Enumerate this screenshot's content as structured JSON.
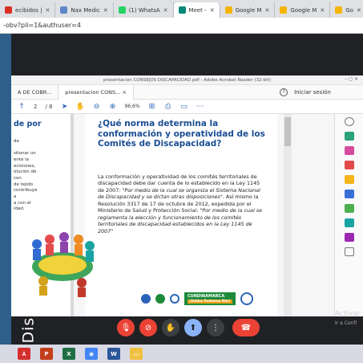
{
  "browser": {
    "tabs": [
      {
        "label": "ecibidos |",
        "color": "#d93025"
      },
      {
        "label": "Nax Medic",
        "color": "#5f86c8"
      },
      {
        "label": "(1) WhatsA",
        "color": "#25d366"
      },
      {
        "label": "Meet -",
        "color": "#00897b"
      },
      {
        "label": "Google M",
        "color": "#f4b400"
      },
      {
        "label": "Google M",
        "color": "#f4b400"
      },
      {
        "label": "Go",
        "color": "#f4b400"
      }
    ],
    "address": "-obv?pli=1&authuser=4"
  },
  "side_text": "Discapacidad",
  "acrobat": {
    "window_title": "presentacion CONSEJOS DISCAPACIDAD.pdf - Adobe Acrobat Reader (32-bit)",
    "window_controls": "–  ◻  ✕",
    "tabs": [
      "A DE COBR...",
      "presentacion CONS...  ×"
    ],
    "help": "?",
    "signin": "Iniciar sesión",
    "toolbar": {
      "page": "2",
      "total": "/ 8",
      "zoom": "96,6%"
    },
    "left_page": {
      "title": "de por",
      "text": "de\n\nstionar un\nente la\necisiones,\nolución de\ncon\nde tejido\ncontribuye\na\na con el\nidad."
    },
    "page": {
      "title": "¿Qué norma determina la conformación y operatividad de los Comités de Discapacidad?",
      "body_plain": "La conformación y operatividad de los comités territoriales de discapacidad debe dar cuenta de lo establecido en la Ley 1145 de 2007: ",
      "body_quote1": "\"Por medio de la cual se organiza el Sistema Nacional de Discapacidad y se dictan otras disposiciones\"",
      "body_mid": ". Así mismo la Resolución 3317 de 17 de octubre de 2012, expedida por el Ministerio de Salud y Protección Social: ",
      "body_quote2": "\"Por medio de la cual se reglamenta la elección y funcionamiento de los comités territoriales de discapacidad establecidos en la Ley 1145 de 2007\"",
      "logo_cund": "CUNDINAMARCA",
      "logo_cund_sub": "¡Unidos Podemos Más!"
    }
  },
  "overlay": {
    "line1": "Activar",
    "line2": "Ir a Confi"
  },
  "taskbar": [
    {
      "name": "acrobat",
      "label": "⅄",
      "color": "#d32f2f"
    },
    {
      "name": "powerpoint",
      "label": "P",
      "color": "#c43e1c"
    },
    {
      "name": "excel",
      "label": "X",
      "color": "#1d6f42"
    },
    {
      "name": "chrome",
      "label": "◉",
      "color": "#4285f4"
    },
    {
      "name": "word",
      "label": "W",
      "color": "#2b579a"
    },
    {
      "name": "explorer",
      "label": "▭",
      "color": "#f0c040"
    }
  ]
}
